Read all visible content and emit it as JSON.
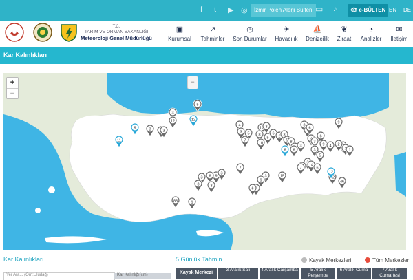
{
  "topbar": {
    "social": [
      "facebook-icon",
      "twitter-icon",
      "youtube-icon",
      "instagram-icon"
    ],
    "polen_label": "İzmir Polen Alerji Bülteni",
    "ebulten_label": "e-BÜLTEN",
    "langs": [
      "EN",
      "DE"
    ]
  },
  "header": {
    "org_tc": "T.C.",
    "org_ministry": "TARIM VE ORMAN BAKANLIĞI",
    "org_name": "Meteoroloji Genel Müdürlüğü",
    "nav": [
      {
        "label": "Kurumsal",
        "icon": "building-icon"
      },
      {
        "label": "Tahminler",
        "icon": "chart-icon"
      },
      {
        "label": "Son Durumlar",
        "icon": "clock-icon"
      },
      {
        "label": "Havacılık",
        "icon": "airplane-icon"
      },
      {
        "label": "Denizcilik",
        "icon": "sailboat-icon"
      },
      {
        "label": "Ziraat",
        "icon": "leaf-icon"
      },
      {
        "label": "Analizler",
        "icon": "analysis-icon"
      },
      {
        "label": "İletişim",
        "icon": "mail-icon"
      }
    ]
  },
  "band_title": "Kar Kalınlıkları",
  "map": {
    "zoom_in": "+",
    "zoom_out": "−",
    "collapse": "−",
    "markers_grey": [
      "5",
      "3",
      "12",
      "3",
      "9",
      "3",
      "4",
      "3",
      "11",
      "3",
      "5",
      "8",
      "5",
      "10",
      "7",
      "6",
      "2",
      "3",
      "5",
      "8",
      "5",
      "3",
      "3",
      "4",
      "6",
      "4",
      "3",
      "6",
      "9",
      "4",
      "1",
      "1",
      "2",
      "1",
      "6",
      "3",
      "9",
      "10",
      "14",
      "7",
      "6",
      "12",
      "9",
      "6",
      "3",
      "3",
      "3",
      "7",
      "15",
      "3",
      "46",
      "9",
      "9",
      "6",
      "3",
      "83",
      "1",
      "3",
      "5"
    ],
    "markers_blue": [
      "12",
      "9",
      "11",
      "6",
      "12"
    ]
  },
  "bottom": {
    "left_title": "Kar Kalınlıkları",
    "input_placeholder": "Yer Ara... (Örn:Uludağ)",
    "grey_bar_label": "Kar Kalınlığı(cm)",
    "forecast_title": "5 Günlük Tahmin",
    "legend_kayak": "Kayak Merkezleri",
    "legend_tum": "Tüm Merkezler",
    "columns": [
      "Kayak Merkezi",
      "3 Aralık Salı",
      "4 Aralık Çarşamba",
      "5 Aralık Perşembe",
      "6 Aralık Cuma",
      "7 Aralık Cumartesi"
    ]
  },
  "colors": {
    "accent": "#25b7cf",
    "sea": "#3fb5e5",
    "land": "#ffffff",
    "marker_grey": "#6b6b6b",
    "marker_blue": "#29a8d8",
    "legend_red": "#e74c3c"
  }
}
